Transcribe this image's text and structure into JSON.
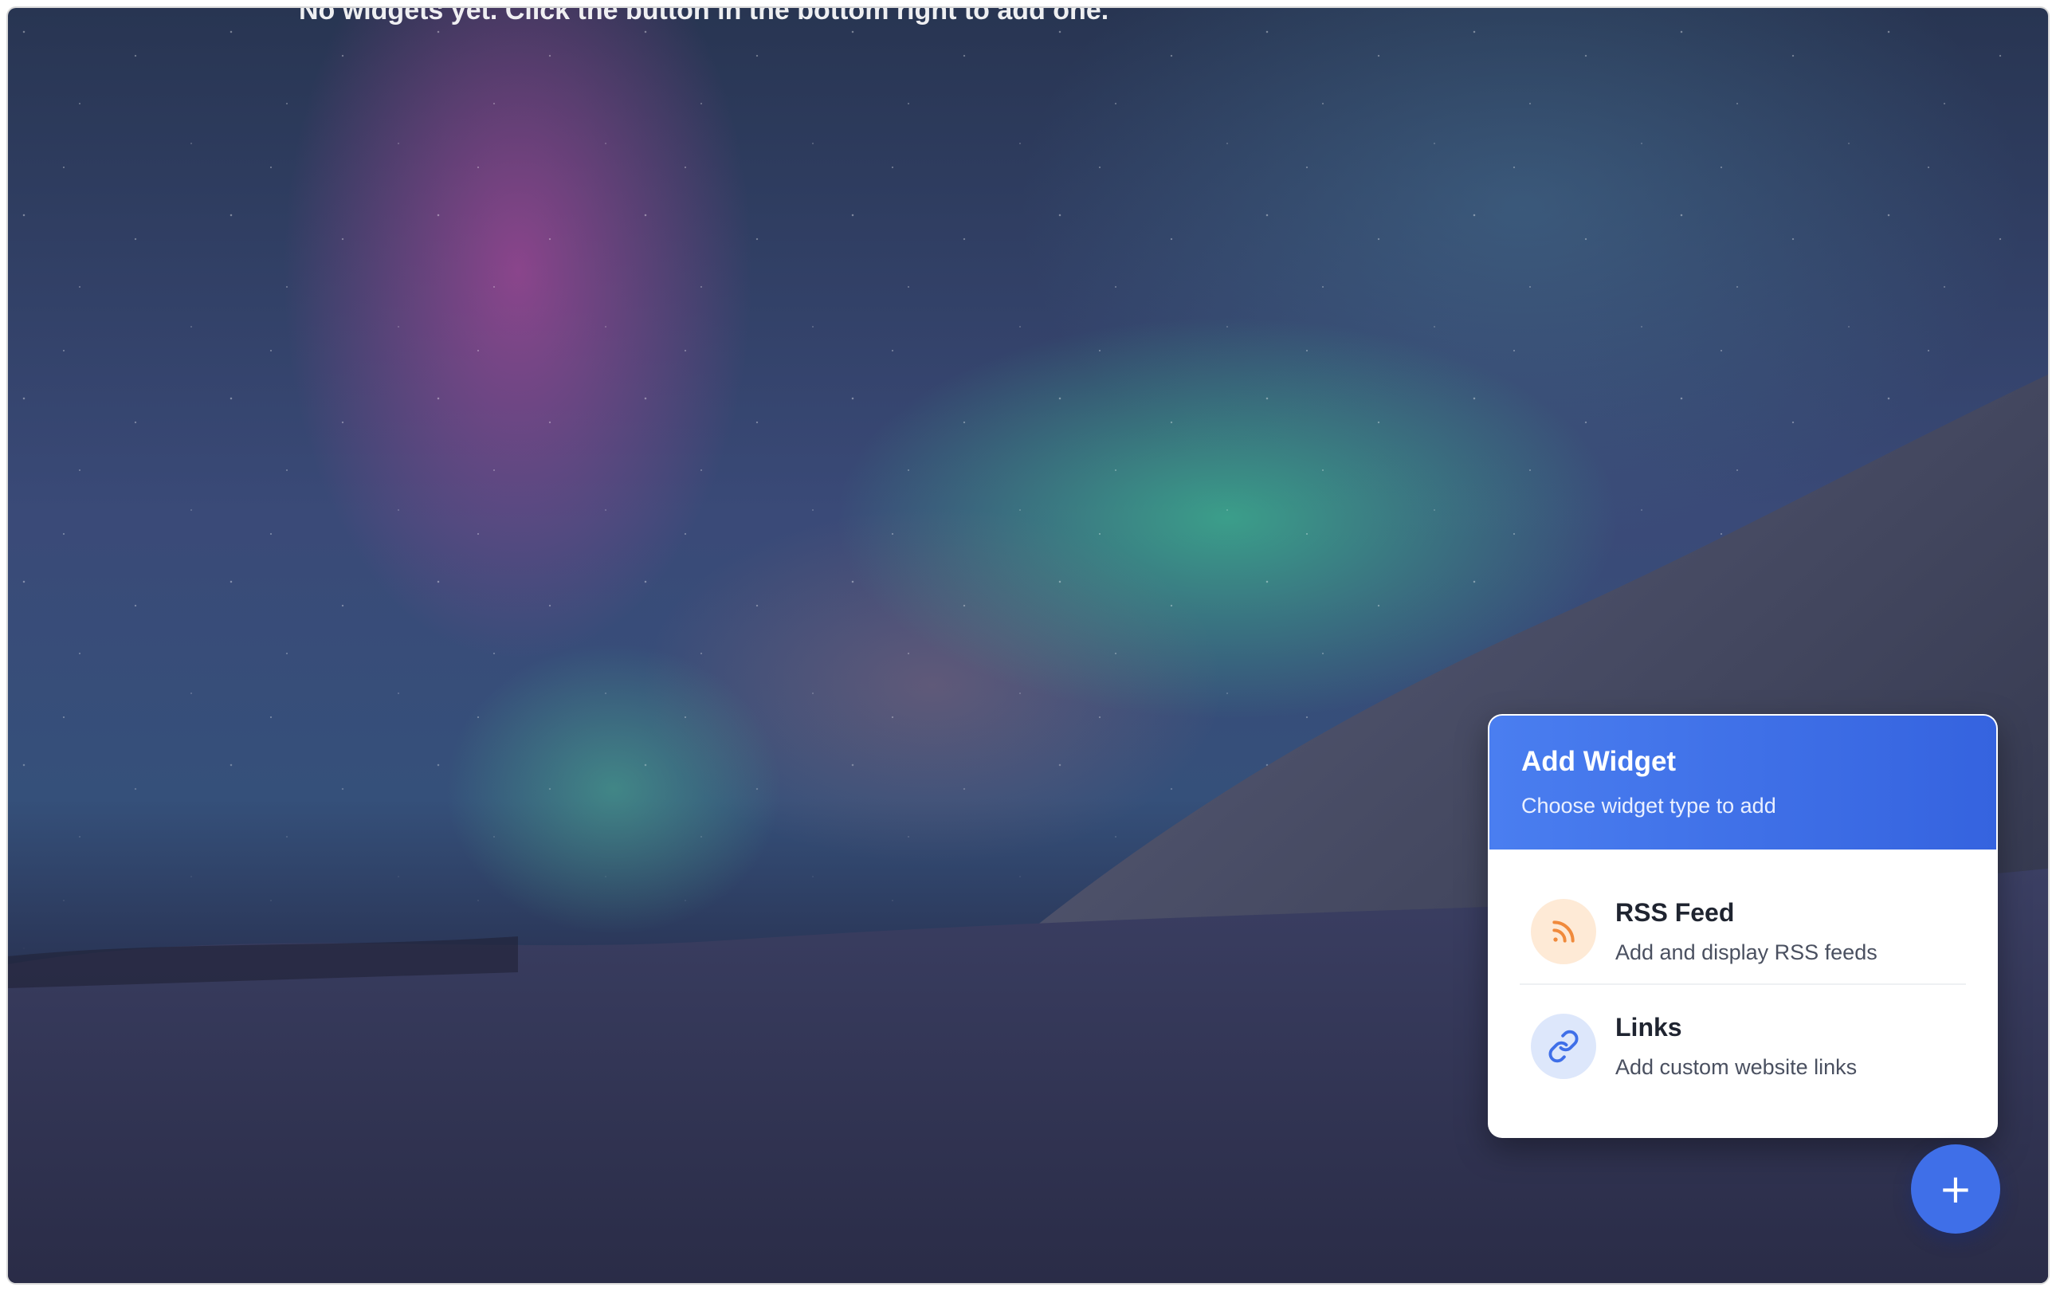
{
  "page": {
    "empty_message": "No widgets yet. Click the button in the bottom right to add one."
  },
  "add_widget_panel": {
    "title": "Add Widget",
    "subtitle": "Choose widget type to add",
    "options": [
      {
        "title": "RSS Feed",
        "description": "Add and display RSS feeds",
        "icon": "rss-icon",
        "accent": "#f08a3c"
      },
      {
        "title": "Links",
        "description": "Add custom website links",
        "icon": "link-icon",
        "accent": "#3f6fe8"
      }
    ]
  },
  "fab": {
    "label": "+",
    "color": "#3f6fe8"
  }
}
